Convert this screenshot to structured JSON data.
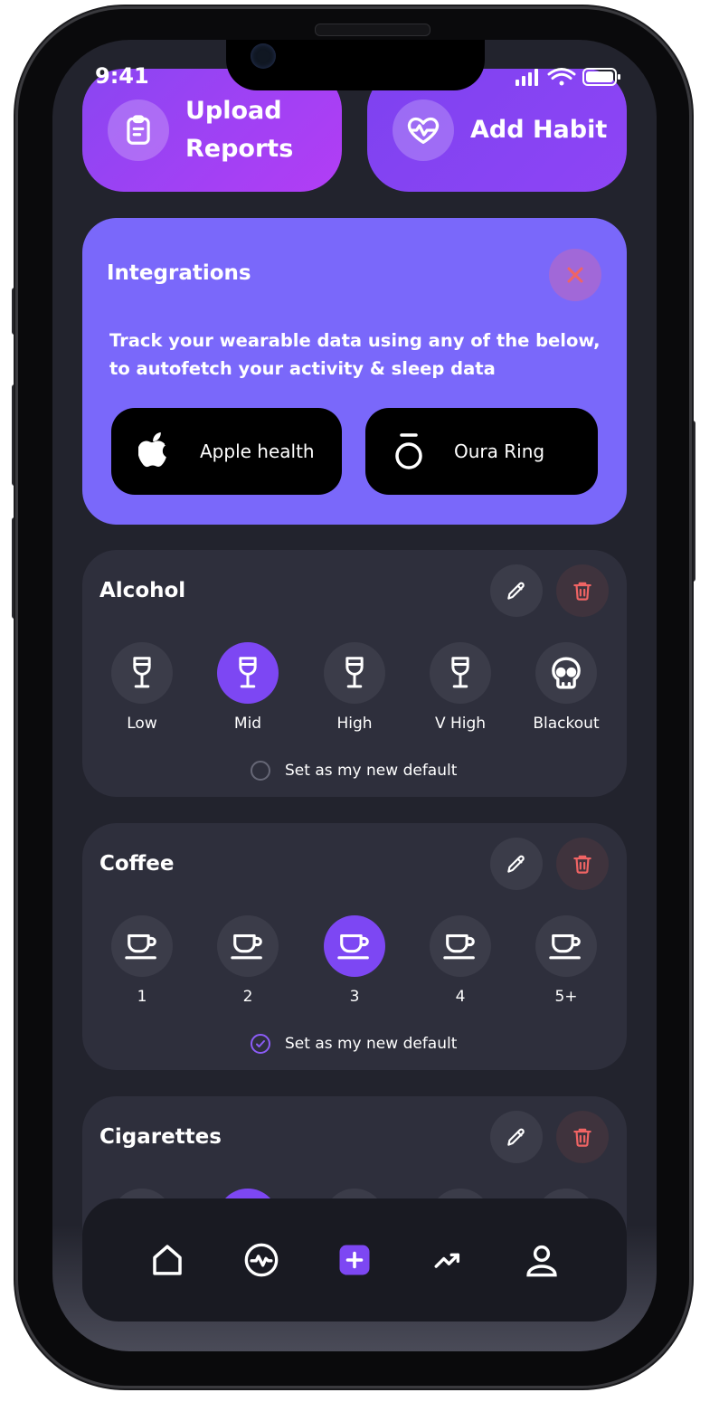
{
  "status_bar": {
    "time": "9:41"
  },
  "actions": {
    "upload": {
      "label_line1": "Upload",
      "label_line2": "Reports",
      "icon": "clipboard-icon"
    },
    "habit": {
      "label": "Add Habit",
      "icon": "heart-pulse-icon"
    }
  },
  "integrations": {
    "title": "Integrations",
    "description_line1": "Track your wearable data using any of the below,",
    "description_line2": "to autofetch your activity & sleep data",
    "options": [
      {
        "label": "Apple health",
        "icon": "apple-icon"
      },
      {
        "label": "Oura Ring",
        "icon": "oura-ring-icon"
      }
    ]
  },
  "habits": [
    {
      "title": "Alcohol",
      "options": [
        {
          "label": "Low",
          "icon": "wine-glass-icon"
        },
        {
          "label": "Mid",
          "icon": "wine-glass-icon"
        },
        {
          "label": "High",
          "icon": "wine-glass-icon"
        },
        {
          "label": "V High",
          "icon": "wine-glass-icon"
        },
        {
          "label": "Blackout",
          "icon": "skull-icon"
        }
      ],
      "selected_index": 1,
      "default_label": "Set as my new default",
      "default_checked": false
    },
    {
      "title": "Coffee",
      "options": [
        {
          "label": "1",
          "icon": "coffee-cup-icon"
        },
        {
          "label": "2",
          "icon": "coffee-cup-icon"
        },
        {
          "label": "3",
          "icon": "coffee-cup-icon"
        },
        {
          "label": "4",
          "icon": "coffee-cup-icon"
        },
        {
          "label": "5+",
          "icon": "coffee-cup-icon"
        }
      ],
      "selected_index": 2,
      "default_label": "Set as my new default",
      "default_checked": true
    },
    {
      "title": "Cigarettes"
    }
  ],
  "nav": [
    "home-icon",
    "activity-icon",
    "add-icon",
    "trend-icon",
    "profile-icon"
  ],
  "colors": {
    "background": "#22232d",
    "card": "#2e2f3c",
    "accent": "#7d47f3",
    "integrations": "#7a68fa",
    "danger": "#f06464"
  }
}
